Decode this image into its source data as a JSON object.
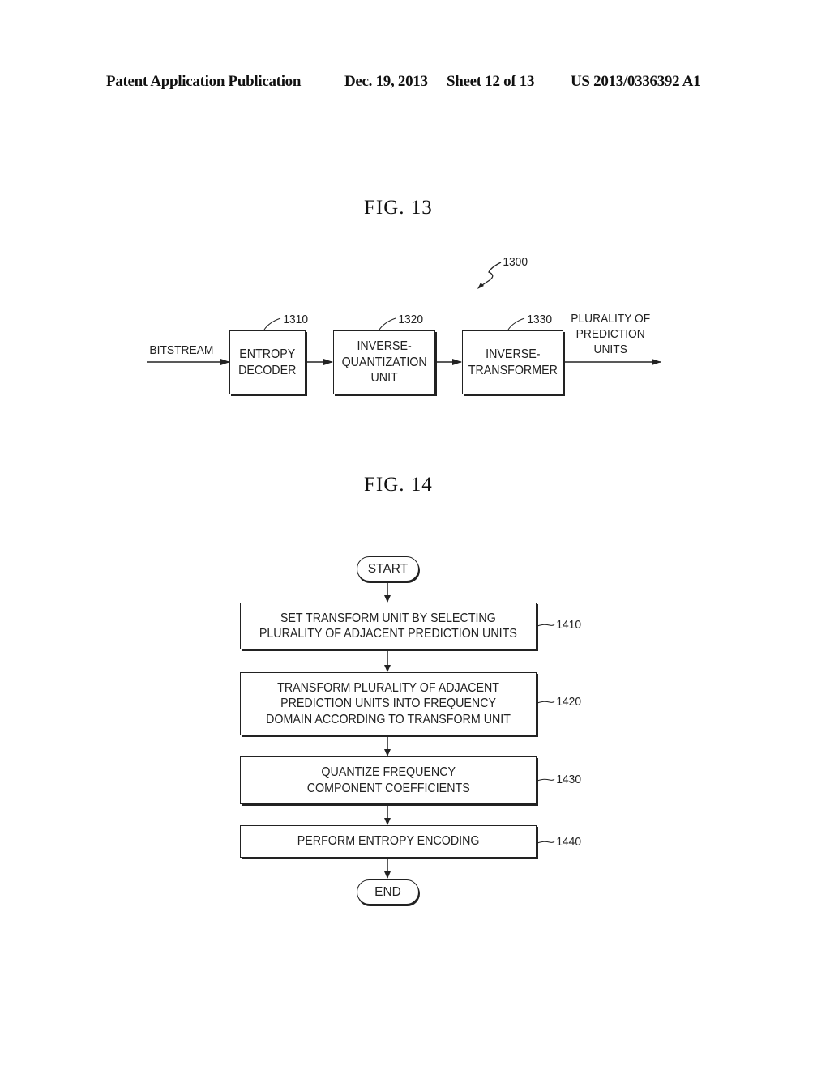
{
  "header": {
    "publication": "Patent Application Publication",
    "date": "Dec. 19, 2013",
    "sheet": "Sheet 12 of 13",
    "number": "US 2013/0336392 A1"
  },
  "fig13": {
    "title": "FIG.  13",
    "ref": "1300",
    "input_label": "BITSTREAM",
    "output_label": "PLURALITY OF\nPREDICTION\nUNITS",
    "blocks": [
      {
        "ref": "1310",
        "label": "ENTROPY\nDECODER"
      },
      {
        "ref": "1320",
        "label": "INVERSE-\nQUANTIZATION\nUNIT"
      },
      {
        "ref": "1330",
        "label": "INVERSE-\nTRANSFORMER"
      }
    ]
  },
  "fig14": {
    "title": "FIG.  14",
    "start": "START",
    "end": "END",
    "steps": [
      {
        "ref": "1410",
        "label": "SET TRANSFORM UNIT BY SELECTING\nPLURALITY OF ADJACENT PREDICTION UNITS"
      },
      {
        "ref": "1420",
        "label": "TRANSFORM PLURALITY OF ADJACENT\nPREDICTION UNITS INTO FREQUENCY\nDOMAIN ACCORDING TO TRANSFORM UNIT"
      },
      {
        "ref": "1430",
        "label": "QUANTIZE FREQUENCY\nCOMPONENT COEFFICIENTS"
      },
      {
        "ref": "1440",
        "label": "PERFORM ENTROPY ENCODING"
      }
    ]
  }
}
